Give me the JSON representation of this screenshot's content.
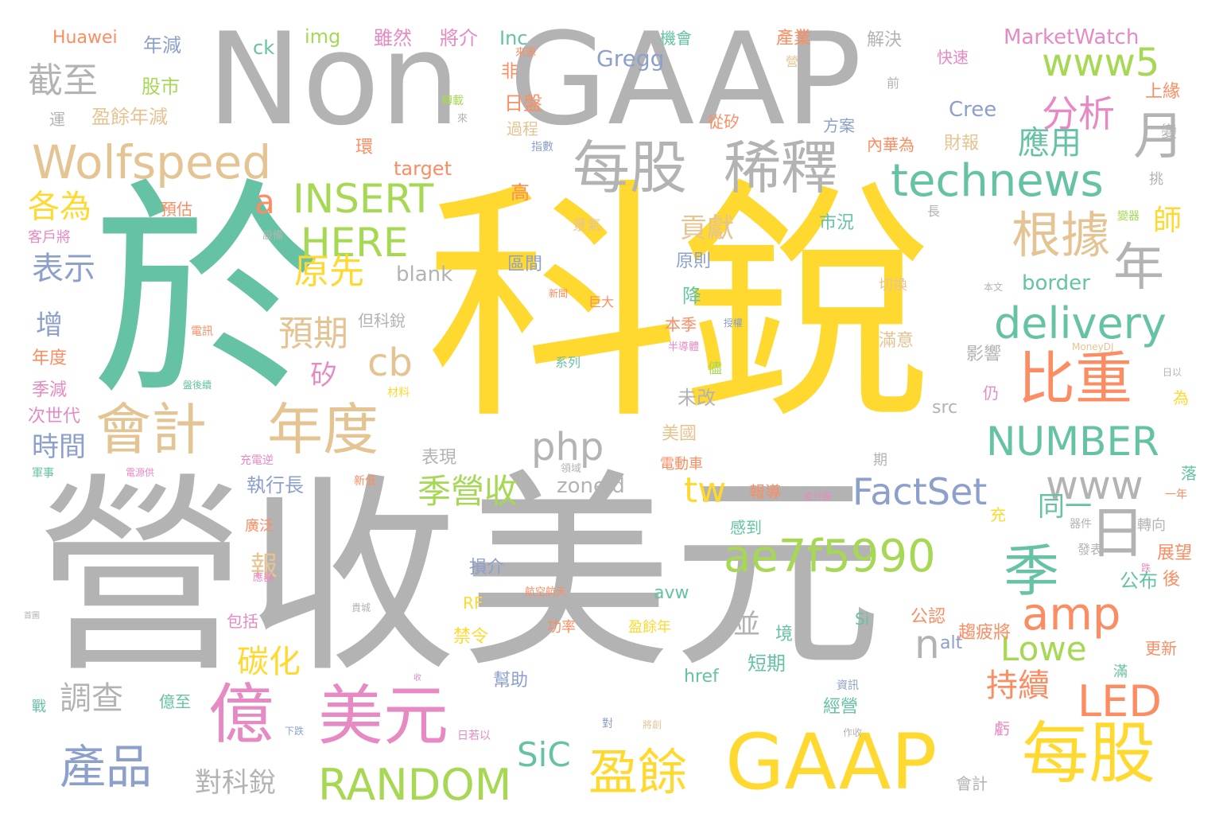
{
  "palette": {
    "gray": "#b3b3b3",
    "teal": "#66c2a5",
    "orange": "#fc8d62",
    "blue": "#8da0cb",
    "pink": "#e78ac3",
    "green": "#a6d854",
    "yellow": "#ffd92f",
    "tan": "#e5c494"
  },
  "words": [
    {
      "text": "科銳",
      "color": "yellow"
    },
    {
      "text": "營收",
      "color": "gray"
    },
    {
      "text": "美元",
      "color": "gray"
    },
    {
      "text": "於",
      "color": "teal"
    },
    {
      "text": "Non",
      "color": "gray"
    },
    {
      "text": "GAAP",
      "color": "gray"
    },
    {
      "text": "GAAP",
      "color": "yellow"
    },
    {
      "text": "每股",
      "color": "yellow"
    },
    {
      "text": "美元",
      "color": "pink"
    },
    {
      "text": "億",
      "color": "pink"
    },
    {
      "text": "每股",
      "color": "gray"
    },
    {
      "text": "稀釋",
      "color": "gray"
    },
    {
      "text": "比重",
      "color": "orange"
    },
    {
      "text": "會計",
      "color": "tan"
    },
    {
      "text": "年度",
      "color": "tan"
    },
    {
      "text": "季",
      "color": "teal"
    },
    {
      "text": "日",
      "color": "gray"
    },
    {
      "text": "年",
      "color": "gray"
    },
    {
      "text": "月",
      "color": "gray"
    },
    {
      "text": "根據",
      "color": "tan"
    },
    {
      "text": "Wolfspeed",
      "color": "tan"
    },
    {
      "text": "technews",
      "color": "teal"
    },
    {
      "text": "ae7f5990",
      "color": "green"
    },
    {
      "text": "amp",
      "color": "orange"
    },
    {
      "text": "delivery",
      "color": "teal"
    },
    {
      "text": "NUMBER",
      "color": "teal"
    },
    {
      "text": "www",
      "color": "gray"
    },
    {
      "text": "www5",
      "color": "green"
    },
    {
      "text": "INSERT",
      "color": "green"
    },
    {
      "text": "HERE",
      "color": "green"
    },
    {
      "text": "RANDOM",
      "color": "green"
    },
    {
      "text": "FactSet",
      "color": "blue"
    },
    {
      "text": "LED",
      "color": "orange"
    },
    {
      "text": "盈餘",
      "color": "yellow"
    },
    {
      "text": "產品",
      "color": "blue"
    },
    {
      "text": "分析",
      "color": "pink"
    },
    {
      "text": "截至",
      "color": "gray"
    },
    {
      "text": "php",
      "color": "gray"
    },
    {
      "text": "cb",
      "color": "tan"
    },
    {
      "text": "n",
      "color": "gray"
    },
    {
      "text": "a",
      "color": "orange"
    },
    {
      "text": "tw",
      "color": "yellow"
    },
    {
      "text": "SiC",
      "color": "teal"
    },
    {
      "text": "Lowe",
      "color": "green"
    },
    {
      "text": "季營收",
      "color": "green"
    },
    {
      "text": "預期",
      "color": "tan"
    },
    {
      "text": "原先",
      "color": "yellow"
    },
    {
      "text": "應用",
      "color": "teal"
    },
    {
      "text": "持續",
      "color": "orange"
    },
    {
      "text": "調查",
      "color": "gray"
    },
    {
      "text": "表示",
      "color": "blue"
    },
    {
      "text": "各為",
      "color": "yellow"
    },
    {
      "text": "碳化",
      "color": "yellow"
    },
    {
      "text": "對科銳",
      "color": "gray"
    },
    {
      "text": "貢獻",
      "color": "tan"
    },
    {
      "text": "師",
      "color": "yellow"
    },
    {
      "text": "增",
      "color": "blue"
    },
    {
      "text": "時間",
      "color": "blue"
    },
    {
      "text": "矽",
      "color": "pink"
    },
    {
      "text": "並",
      "color": "gray"
    },
    {
      "text": "同一",
      "color": "teal"
    },
    {
      "text": "報",
      "color": "tan"
    },
    {
      "text": "年減",
      "color": "blue"
    },
    {
      "text": "股市",
      "color": "green"
    },
    {
      "text": "盈餘年減",
      "color": "tan"
    },
    {
      "text": "ck",
      "color": "teal"
    },
    {
      "text": "img",
      "color": "green"
    },
    {
      "text": "雖然",
      "color": "pink"
    },
    {
      "text": "將介",
      "color": "pink"
    },
    {
      "text": "Inc",
      "color": "teal"
    },
    {
      "text": "機會",
      "color": "teal"
    },
    {
      "text": "產業",
      "color": "orange"
    },
    {
      "text": "解決",
      "color": "gray"
    },
    {
      "text": "MarketWatch",
      "color": "pink"
    },
    {
      "text": "Huawei",
      "color": "orange"
    },
    {
      "text": "Gregg",
      "color": "blue"
    },
    {
      "text": "Cree",
      "color": "blue"
    },
    {
      "text": "target",
      "color": "orange"
    },
    {
      "text": "blank",
      "color": "gray"
    },
    {
      "text": "border",
      "color": "teal"
    },
    {
      "text": "zoneid",
      "color": "gray"
    },
    {
      "text": "src",
      "color": "gray"
    },
    {
      "text": "alt",
      "color": "blue"
    },
    {
      "text": "href",
      "color": "teal"
    },
    {
      "text": "avw",
      "color": "teal"
    },
    {
      "text": "Si",
      "color": "teal"
    },
    {
      "text": "RF",
      "color": "yellow"
    },
    {
      "text": "日盤",
      "color": "orange"
    },
    {
      "text": "非",
      "color": "orange"
    },
    {
      "text": "高",
      "color": "orange"
    },
    {
      "text": "區間",
      "color": "blue"
    },
    {
      "text": "降",
      "color": "teal"
    },
    {
      "text": "原則",
      "color": "blue"
    },
    {
      "text": "本季",
      "color": "orange"
    },
    {
      "text": "未改",
      "color": "gray"
    },
    {
      "text": "美國",
      "color": "tan"
    },
    {
      "text": "表現",
      "color": "gray"
    },
    {
      "text": "執行長",
      "color": "blue"
    },
    {
      "text": "損介",
      "color": "blue"
    },
    {
      "text": "禁令",
      "color": "yellow"
    },
    {
      "text": "幫助",
      "color": "blue"
    },
    {
      "text": "短期",
      "color": "teal"
    },
    {
      "text": "經營",
      "color": "teal"
    },
    {
      "text": "公認",
      "color": "orange"
    },
    {
      "text": "趨疲將",
      "color": "orange"
    },
    {
      "text": "公布",
      "color": "teal"
    },
    {
      "text": "展望",
      "color": "orange"
    },
    {
      "text": "後",
      "color": "orange"
    },
    {
      "text": "更新",
      "color": "orange"
    },
    {
      "text": "滿意",
      "color": "tan"
    },
    {
      "text": "影響",
      "color": "gray"
    },
    {
      "text": "仍",
      "color": "pink"
    },
    {
      "text": "市況",
      "color": "teal"
    },
    {
      "text": "財報",
      "color": "tan"
    },
    {
      "text": "方案",
      "color": "blue"
    },
    {
      "text": "上緣",
      "color": "orange"
    },
    {
      "text": "快速",
      "color": "pink"
    },
    {
      "text": "變",
      "color": "gray"
    },
    {
      "text": "挑",
      "color": "gray"
    },
    {
      "text": "從矽",
      "color": "orange"
    },
    {
      "text": "內華為",
      "color": "orange"
    },
    {
      "text": "環",
      "color": "orange"
    },
    {
      "text": "過程",
      "color": "tan"
    },
    {
      "text": "預估",
      "color": "orange"
    },
    {
      "text": "客戶將",
      "color": "pink"
    },
    {
      "text": "年度",
      "color": "orange"
    },
    {
      "text": "季減",
      "color": "pink"
    },
    {
      "text": "次世代",
      "color": "pink"
    },
    {
      "text": "戰",
      "color": "teal"
    },
    {
      "text": "億至",
      "color": "teal"
    },
    {
      "text": "包括",
      "color": "pink"
    },
    {
      "text": "會計",
      "color": "gray"
    },
    {
      "text": "虧",
      "color": "pink"
    },
    {
      "text": "滿",
      "color": "teal"
    },
    {
      "text": "境",
      "color": "teal"
    },
    {
      "text": "但科銳",
      "color": "gray"
    },
    {
      "text": "運",
      "color": "gray"
    },
    {
      "text": "功率",
      "color": "orange"
    },
    {
      "text": "盈餘年",
      "color": "yellow"
    },
    {
      "text": "系列",
      "color": "teal"
    },
    {
      "text": "巨大",
      "color": "orange"
    },
    {
      "text": "切換",
      "color": "tan"
    },
    {
      "text": "電動車",
      "color": "orange"
    },
    {
      "text": "報導",
      "color": "orange"
    },
    {
      "text": "充",
      "color": "yellow"
    },
    {
      "text": "轉向",
      "color": "gray"
    },
    {
      "text": "發表",
      "color": "gray"
    },
    {
      "text": "落",
      "color": "teal"
    },
    {
      "text": "為",
      "color": "yellow"
    },
    {
      "text": "儘",
      "color": "green"
    },
    {
      "text": "期",
      "color": "gray"
    },
    {
      "text": "長",
      "color": "gray"
    },
    {
      "text": "前",
      "color": "gray"
    },
    {
      "text": "營",
      "color": "tan"
    },
    {
      "text": "對",
      "color": "blue"
    },
    {
      "text": "作收",
      "color": "gray"
    },
    {
      "text": "資訊",
      "color": "blue"
    },
    {
      "text": "器件",
      "color": "gray"
    },
    {
      "text": "一年",
      "color": "orange"
    },
    {
      "text": "成分股",
      "color": "pink"
    },
    {
      "text": "充電逆",
      "color": "pink"
    },
    {
      "text": "電源供",
      "color": "pink"
    },
    {
      "text": "軍事",
      "color": "teal"
    },
    {
      "text": "新低",
      "color": "orange"
    },
    {
      "text": "領域",
      "color": "gray"
    },
    {
      "text": "航空航天",
      "color": "orange"
    },
    {
      "text": "材料",
      "color": "yellow"
    },
    {
      "text": "半導體",
      "color": "pink"
    },
    {
      "text": "授權",
      "color": "blue"
    },
    {
      "text": "新聞",
      "color": "orange"
    },
    {
      "text": "景氣",
      "color": "tan"
    },
    {
      "text": "指數",
      "color": "blue"
    },
    {
      "text": "轉載",
      "color": "green"
    },
    {
      "text": "來源",
      "color": "orange"
    },
    {
      "text": "來",
      "color": "gray"
    },
    {
      "text": "設備",
      "color": "gray"
    },
    {
      "text": "變器",
      "color": "green"
    },
    {
      "text": "本文",
      "color": "gray"
    },
    {
      "text": "MoneyDJ",
      "color": "tan"
    },
    {
      "text": "日以",
      "color": "gray"
    },
    {
      "text": "跌",
      "color": "pink"
    },
    {
      "text": "首圖",
      "color": "gray"
    },
    {
      "text": "應器",
      "color": "pink"
    },
    {
      "text": "貴城",
      "color": "gray"
    },
    {
      "text": "收",
      "color": "pink"
    },
    {
      "text": "日若以",
      "color": "pink"
    },
    {
      "text": "下跌",
      "color": "blue"
    },
    {
      "text": "將創",
      "color": "tan"
    },
    {
      "text": "廣泛",
      "color": "orange"
    },
    {
      "text": "感到",
      "color": "teal"
    },
    {
      "text": "電訊",
      "color": "orange"
    },
    {
      "text": "盤後續",
      "color": "teal"
    }
  ]
}
